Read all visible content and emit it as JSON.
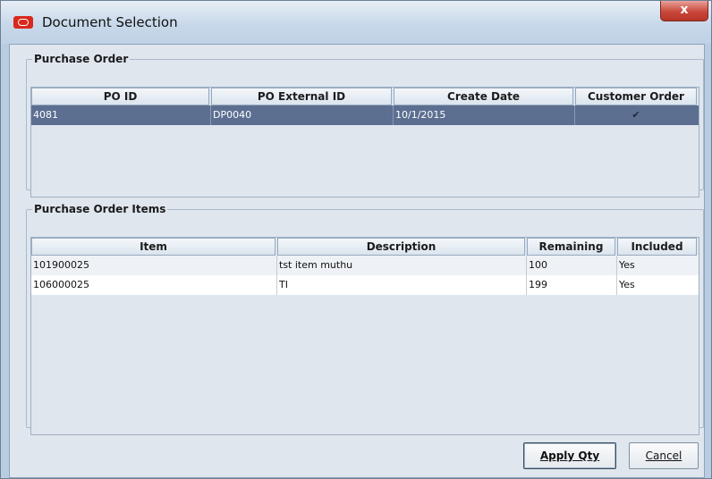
{
  "window": {
    "title": "Document Selection",
    "close_label": "x"
  },
  "purchase_order": {
    "legend": "Purchase Order",
    "columns": [
      "PO ID",
      "PO External ID",
      "Create Date",
      "Customer Order"
    ],
    "rows": [
      {
        "po_id": "4081",
        "po_external_id": "DP0040",
        "create_date": "10/1/2015",
        "customer_order": "✔"
      }
    ]
  },
  "purchase_order_items": {
    "legend": "Purchase Order Items",
    "columns": [
      "Item",
      "Description",
      "Remaining",
      "Included"
    ],
    "rows": [
      {
        "item": "101900025",
        "description": "tst item muthu",
        "remaining": "100",
        "included": "Yes"
      },
      {
        "item": "106000025",
        "description": "TI",
        "remaining": "199",
        "included": "Yes"
      }
    ]
  },
  "buttons": {
    "apply": "Apply Qty",
    "cancel": "Cancel"
  }
}
